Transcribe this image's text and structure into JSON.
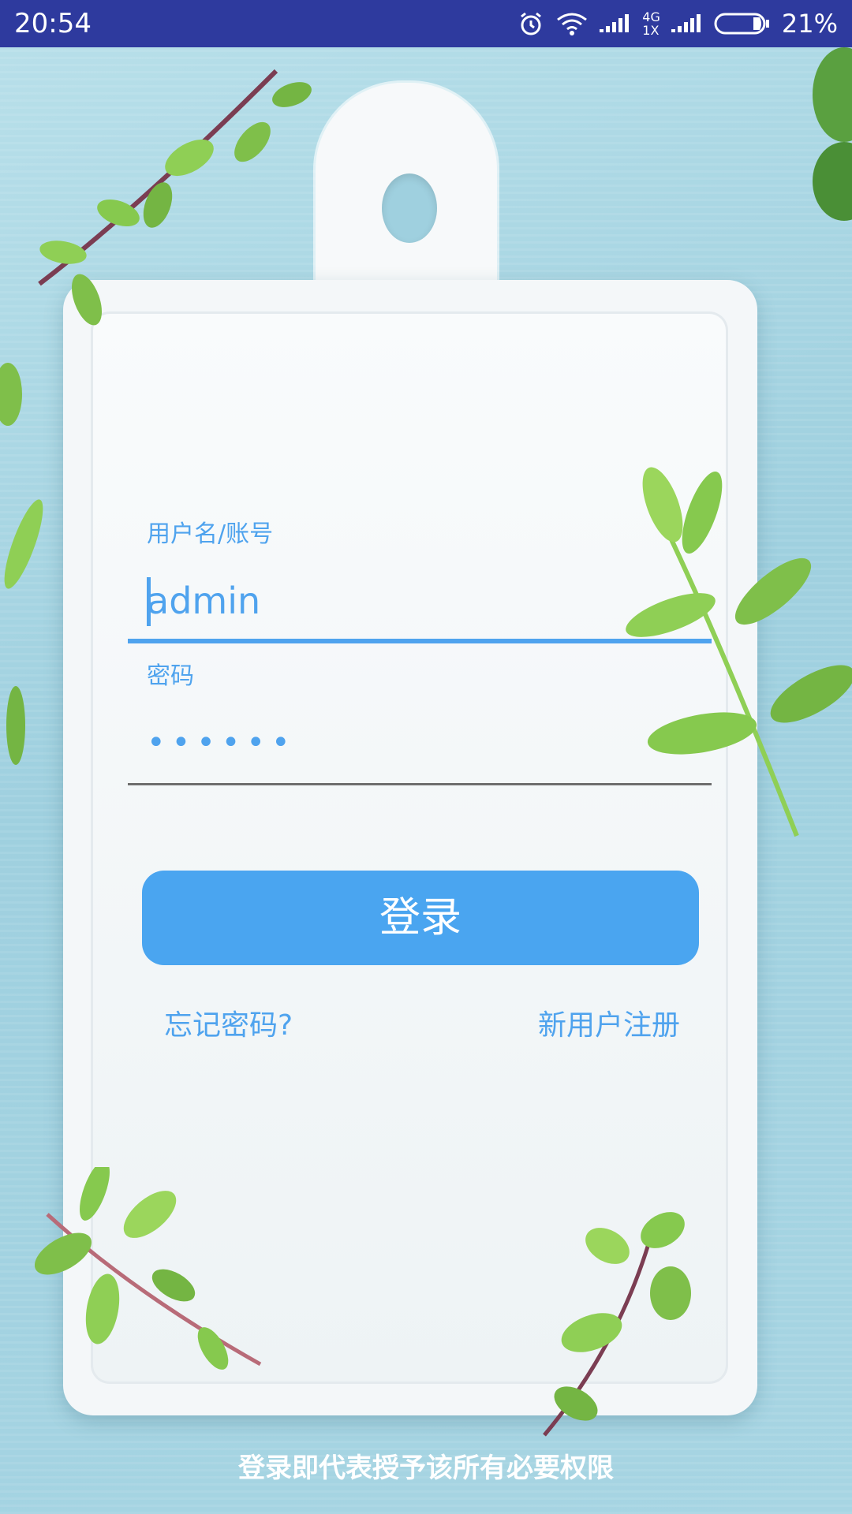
{
  "status_bar": {
    "time": "20:54",
    "network_label_top": "4G",
    "network_label_bottom": "1X",
    "battery_percent": "21%",
    "icons": [
      "alarm-icon",
      "wifi-icon",
      "signal-icon",
      "signal-icon",
      "battery-icon"
    ],
    "background_color": "#2e3a9e"
  },
  "login_form": {
    "username_label": "用户名/账号",
    "username_value": "admin",
    "password_label": "密码",
    "password_value_masked": "••••••",
    "login_button_label": "登录",
    "forgot_password_link": "忘记密码?",
    "register_link": "新用户注册",
    "accent_color": "#4fa3ee"
  },
  "footer": {
    "note": "登录即代表授予该所有必要权限"
  }
}
